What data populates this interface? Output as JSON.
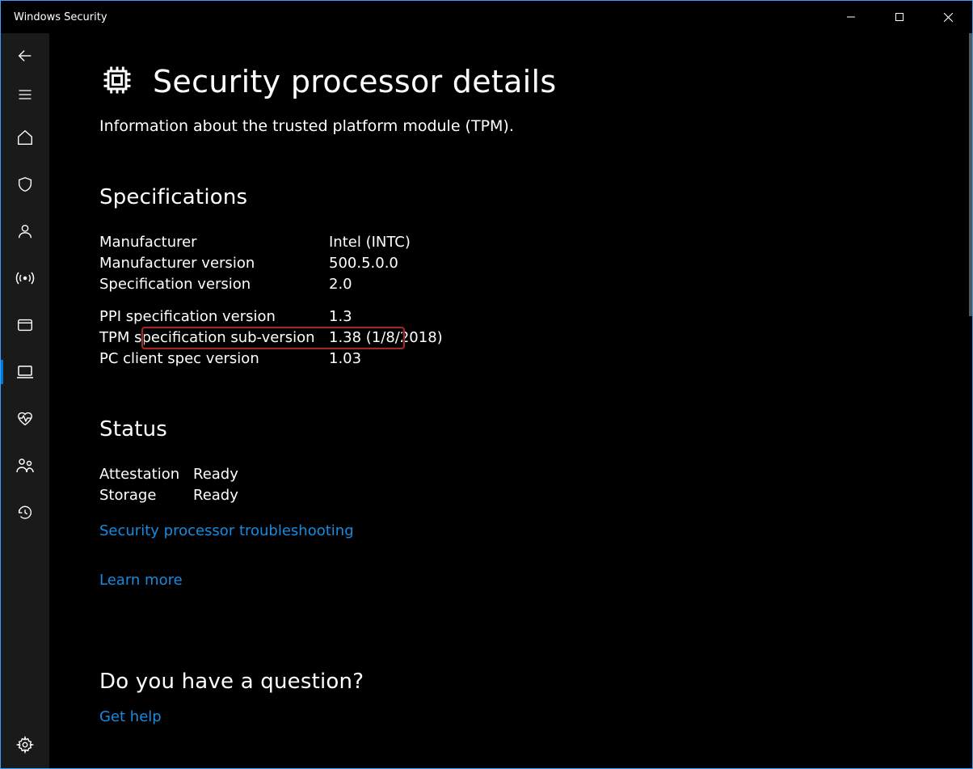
{
  "window": {
    "title": "Windows Security"
  },
  "page": {
    "title": "Security processor details",
    "subtitle": "Information about the trusted platform module (TPM)."
  },
  "specifications": {
    "heading": "Specifications",
    "rows": [
      {
        "label": "Manufacturer",
        "value": "Intel (INTC)"
      },
      {
        "label": "Manufacturer version",
        "value": "500.5.0.0"
      },
      {
        "label": "Specification version",
        "value": "2.0",
        "highlighted": true
      },
      {
        "label": "PPI specification version",
        "value": "1.3"
      },
      {
        "label": "TPM specification sub-version",
        "value": "1.38 (1/8/2018)"
      },
      {
        "label": "PC client spec version",
        "value": "1.03"
      }
    ]
  },
  "status": {
    "heading": "Status",
    "rows": [
      {
        "label": "Attestation",
        "value": "Ready"
      },
      {
        "label": "Storage",
        "value": "Ready"
      }
    ]
  },
  "links": {
    "troubleshoot": "Security processor troubleshooting",
    "learn_more": "Learn more",
    "get_help": "Get help"
  },
  "question": {
    "heading": "Do you have a question?"
  },
  "sidebar": {
    "back": "Back",
    "menu": "Menu",
    "items": [
      {
        "name": "home",
        "icon": "home"
      },
      {
        "name": "virus-threat",
        "icon": "shield"
      },
      {
        "name": "account",
        "icon": "person"
      },
      {
        "name": "firewall-network",
        "icon": "network"
      },
      {
        "name": "app-browser",
        "icon": "window"
      },
      {
        "name": "device-security",
        "icon": "laptop",
        "active": true
      },
      {
        "name": "device-performance",
        "icon": "heart"
      },
      {
        "name": "family",
        "icon": "family"
      },
      {
        "name": "protection-history",
        "icon": "history"
      }
    ],
    "settings": "Settings"
  }
}
